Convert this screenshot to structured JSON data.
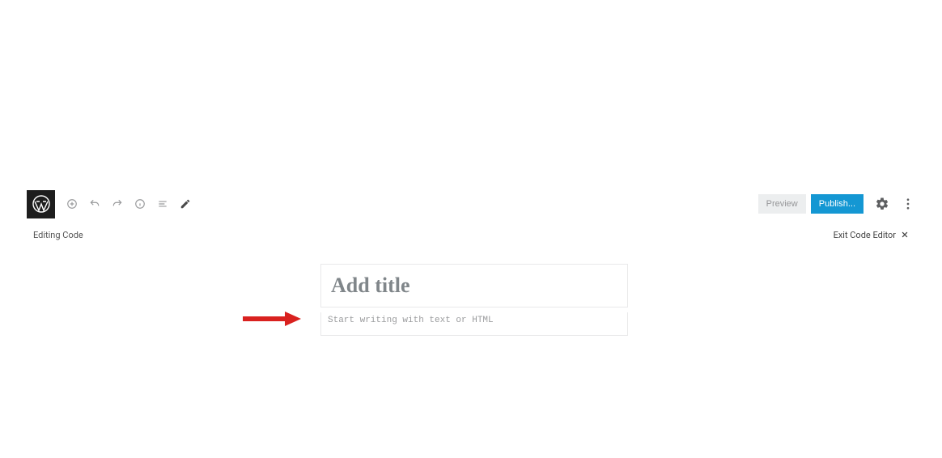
{
  "toolbar": {
    "logo_name": "wordpress-logo",
    "preview_label": "Preview",
    "publish_label": "Publish..."
  },
  "subbar": {
    "mode_label": "Editing Code",
    "exit_label": "Exit Code Editor"
  },
  "editor": {
    "title_placeholder": "Add title",
    "title_value": "",
    "body_placeholder": "Start writing with text or HTML",
    "body_value": ""
  },
  "colors": {
    "publish": "#1497d3",
    "preview_bg": "#eceeef",
    "arrow": "#d9211f"
  }
}
